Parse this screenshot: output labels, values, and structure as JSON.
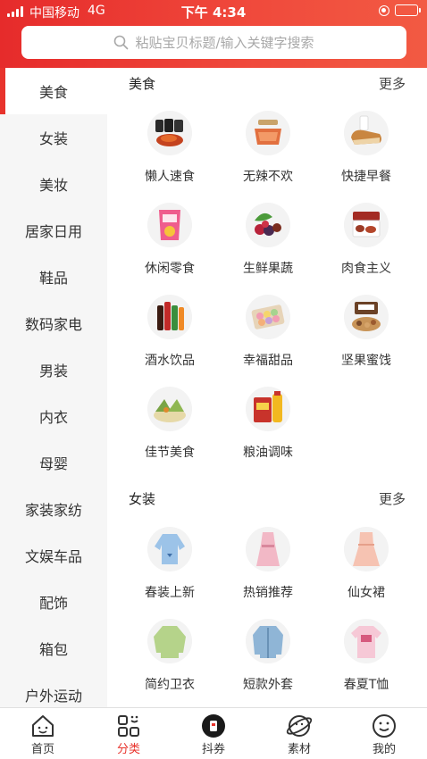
{
  "status_bar": {
    "carrier": "中国移动",
    "network": "4G",
    "time": "下午 4:34"
  },
  "search": {
    "placeholder": "粘贴宝贝标题/输入关键字搜索",
    "icon": "search-icon"
  },
  "sidebar": {
    "items": [
      {
        "label": "美食",
        "active": true
      },
      {
        "label": "女装"
      },
      {
        "label": "美妆"
      },
      {
        "label": "居家日用"
      },
      {
        "label": "鞋品"
      },
      {
        "label": "数码家电"
      },
      {
        "label": "男装"
      },
      {
        "label": "内衣"
      },
      {
        "label": "母婴"
      },
      {
        "label": "家装家纺"
      },
      {
        "label": "文娱车品"
      },
      {
        "label": "配饰"
      },
      {
        "label": "箱包"
      },
      {
        "label": "户外运动"
      }
    ]
  },
  "sections": [
    {
      "title": "美食",
      "more": "更多",
      "items": [
        {
          "label": "懒人速食",
          "icon": "instant-food-icon"
        },
        {
          "label": "无辣不欢",
          "icon": "spicy-meat-icon"
        },
        {
          "label": "快捷早餐",
          "icon": "bread-milk-icon"
        },
        {
          "label": "休闲零食",
          "icon": "snack-bag-icon"
        },
        {
          "label": "生鲜果蔬",
          "icon": "fresh-fruit-icon"
        },
        {
          "label": "肉食主义",
          "icon": "meat-box-icon"
        },
        {
          "label": "酒水饮品",
          "icon": "drink-bottles-icon"
        },
        {
          "label": "幸福甜品",
          "icon": "macaron-box-icon"
        },
        {
          "label": "坚果蜜饯",
          "icon": "nuts-box-icon"
        },
        {
          "label": "佳节美食",
          "icon": "zongzi-icon"
        },
        {
          "label": "粮油调味",
          "icon": "rice-oil-icon"
        }
      ]
    },
    {
      "title": "女装",
      "more": "更多",
      "items": [
        {
          "label": "春装上新",
          "icon": "blue-blouse-icon"
        },
        {
          "label": "热销推荐",
          "icon": "pink-dress-icon"
        },
        {
          "label": "仙女裙",
          "icon": "fairy-dress-icon"
        },
        {
          "label": "简约卫衣",
          "icon": "green-sweater-icon"
        },
        {
          "label": "短款外套",
          "icon": "denim-jacket-icon"
        },
        {
          "label": "春夏T恤",
          "icon": "pink-tshirt-icon"
        }
      ]
    }
  ],
  "tabbar": {
    "items": [
      {
        "label": "首页",
        "icon": "home-icon"
      },
      {
        "label": "分类",
        "icon": "category-icon",
        "active": true
      },
      {
        "label": "抖券",
        "icon": "douyin-coupon-icon"
      },
      {
        "label": "素材",
        "icon": "planet-icon"
      },
      {
        "label": "我的",
        "icon": "smile-face-icon"
      }
    ]
  },
  "colors": {
    "brand_red": "#e8332c",
    "sidebar_bg": "#f6f6f6",
    "placeholder": "#a8a8a8"
  }
}
